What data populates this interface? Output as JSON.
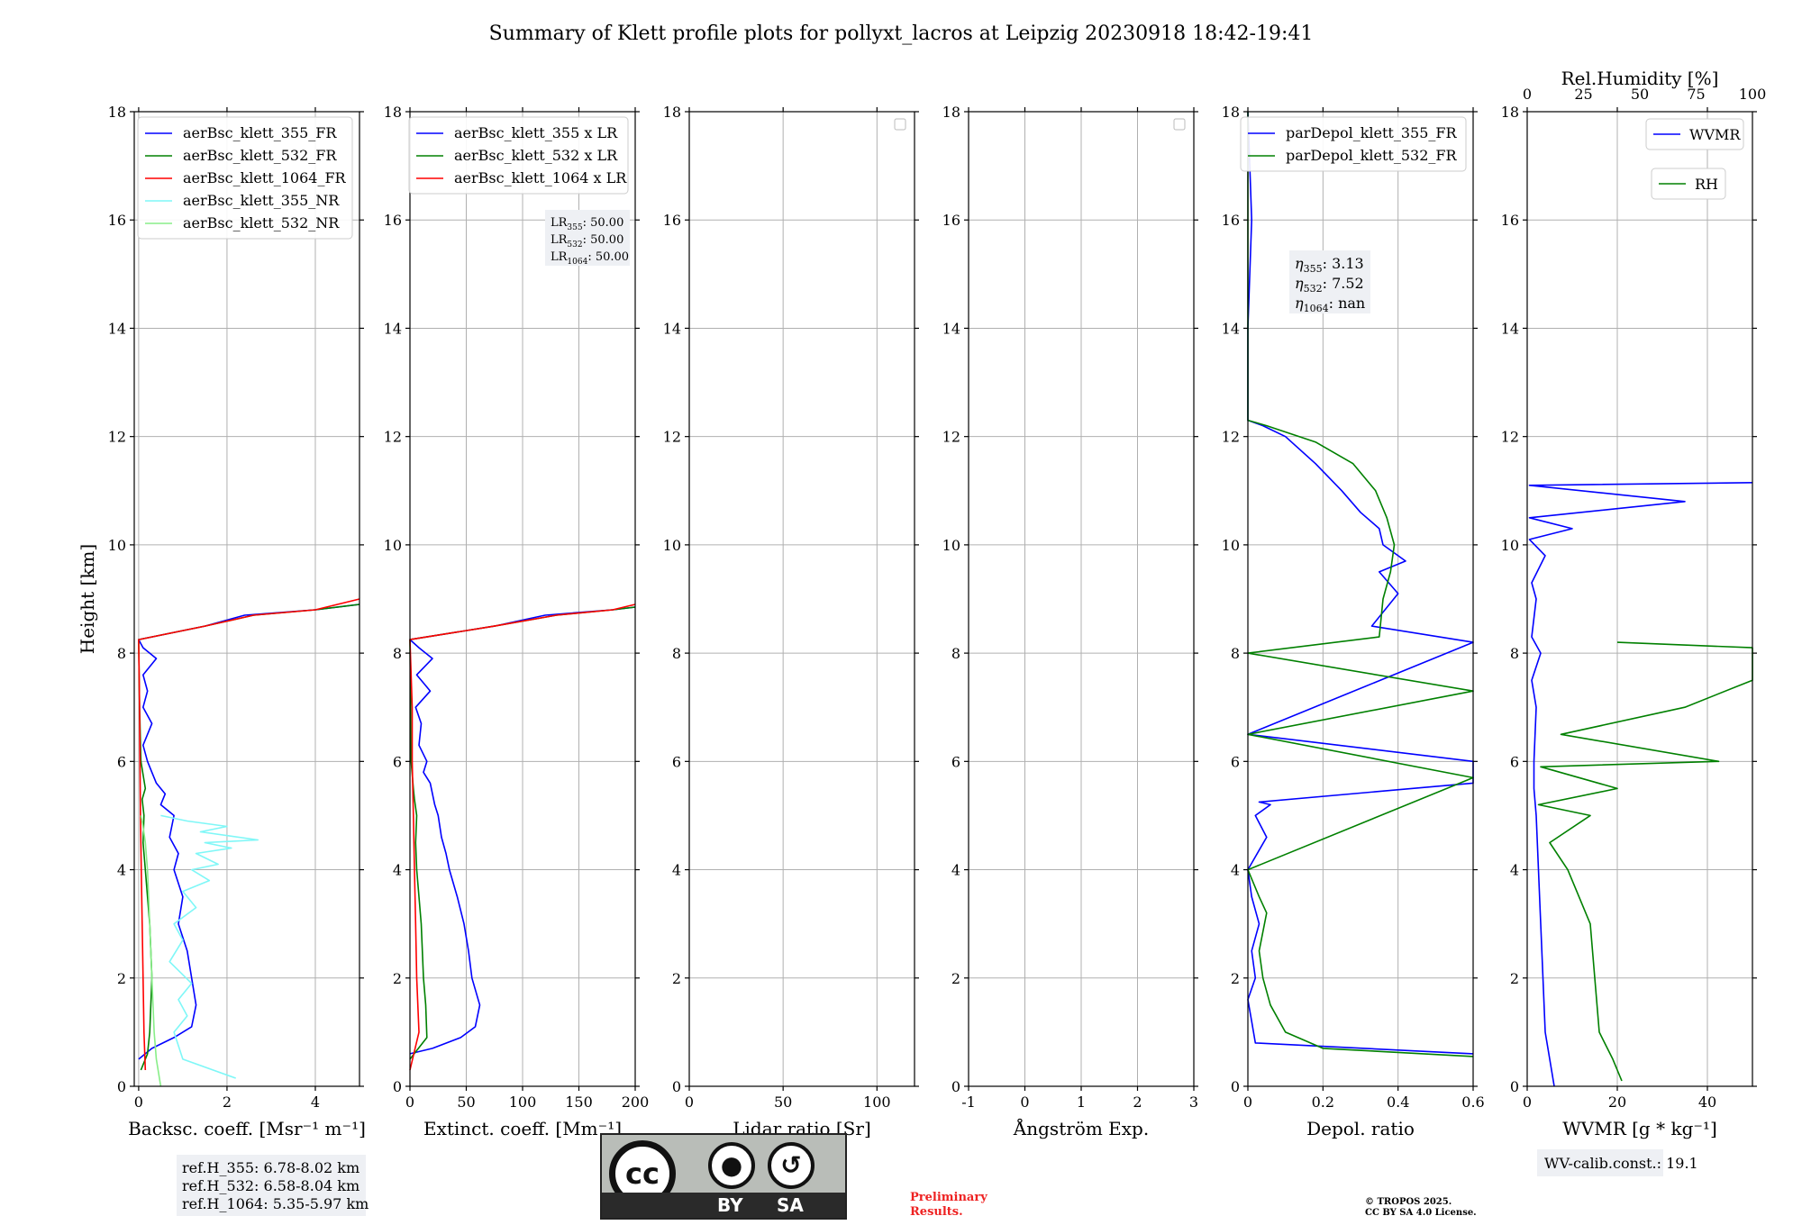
{
  "figure": {
    "title": "Summary of Klett profile plots for pollyxt_lacros at Leipzig 20230918 18:42-19:41",
    "ylabel": "Height [km]",
    "preliminary": [
      "Preliminary",
      "Results."
    ],
    "copyright": [
      "© TROPOS 2025.",
      "CC BY SA 4.0 License."
    ],
    "license": {
      "main": "cc",
      "left": "BY",
      "right": "SA"
    },
    "colors": {
      "b355": "#0000ff",
      "g532": "#008000",
      "r1064": "#ff0000",
      "c355nr": "#7ff7f7",
      "l532nr": "#88ee88"
    }
  },
  "chart_data": [
    {
      "type": "line",
      "xlabel": "Backsc. coeff. [Msr⁻¹ m⁻¹]",
      "xlim": [
        -0.1,
        5
      ],
      "ylim": [
        0,
        18
      ],
      "xticks": [
        0,
        2,
        4
      ],
      "yticks": [
        0,
        2,
        4,
        6,
        8,
        10,
        12,
        14,
        16,
        18
      ],
      "grid": true,
      "legend": "top-right",
      "series": [
        {
          "name": "aerBsc_klett_355_FR",
          "color": "#0000ff",
          "x": [
            0,
            0.3,
            0.8,
            1.2,
            1.3,
            1.2,
            1.1,
            0.9,
            1.0,
            0.8,
            0.9,
            0.7,
            0.8,
            0.5,
            0.6,
            0.4,
            0.3,
            0.2,
            0.1,
            0.3,
            0.1,
            0.2,
            0.1,
            0.4,
            0.1,
            0.0,
            1.5,
            2.4,
            4.0,
            5.0
          ],
          "y": [
            0.5,
            0.7,
            0.9,
            1.1,
            1.5,
            2.0,
            2.5,
            3.0,
            3.5,
            4.0,
            4.3,
            4.6,
            5.0,
            5.2,
            5.4,
            5.6,
            5.8,
            6.0,
            6.3,
            6.7,
            7.0,
            7.3,
            7.6,
            7.9,
            8.1,
            8.25,
            8.5,
            8.7,
            8.8,
            8.9
          ]
        },
        {
          "name": "aerBsc_klett_532_FR",
          "color": "#008000",
          "x": [
            0.05,
            0.2,
            0.25,
            0.3,
            0.25,
            0.2,
            0.15,
            0.1,
            0.12,
            0.08,
            0.15,
            0.05,
            0.02,
            0.0,
            1.5,
            2.6,
            4.0,
            5.0
          ],
          "y": [
            0.3,
            0.6,
            1.0,
            2.0,
            3.0,
            3.5,
            4.0,
            4.5,
            5.0,
            5.3,
            5.5,
            6.0,
            7.0,
            8.25,
            8.5,
            8.7,
            8.8,
            8.9
          ]
        },
        {
          "name": "aerBsc_klett_1064_FR",
          "color": "#ff0000",
          "x": [
            0.15,
            0.12,
            0.1,
            0.08,
            0.06,
            0.04,
            0.03,
            0.02,
            0.0,
            1.5,
            2.6,
            4.0,
            5.0
          ],
          "y": [
            0.3,
            1.0,
            2.0,
            3.0,
            4.0,
            5.0,
            6.0,
            7.0,
            8.25,
            8.5,
            8.7,
            8.8,
            9.0
          ]
        },
        {
          "name": "aerBsc_klett_355_NR",
          "color": "#7ff7f7",
          "x": [
            2.2,
            1.0,
            0.8,
            1.1,
            0.9,
            1.2,
            0.7,
            1.0,
            0.8,
            1.3,
            1.0,
            1.6,
            1.2,
            1.8,
            1.3,
            2.1,
            1.5,
            2.7,
            1.4,
            2.0,
            1.1,
            0.5
          ],
          "y": [
            0.15,
            0.5,
            1.0,
            1.3,
            1.6,
            1.9,
            2.3,
            2.7,
            3.0,
            3.3,
            3.6,
            3.8,
            4.0,
            4.1,
            4.3,
            4.4,
            4.5,
            4.55,
            4.7,
            4.8,
            4.9,
            5.0
          ]
        },
        {
          "name": "aerBsc_klett_532_NR",
          "color": "#88ee88",
          "x": [
            0.5,
            0.4,
            0.35,
            0.3,
            0.25,
            0.2,
            0.15,
            0.1,
            0.05
          ],
          "y": [
            0.0,
            0.5,
            1.0,
            2.0,
            3.0,
            4.0,
            4.5,
            4.8,
            5.0
          ]
        }
      ],
      "note": [
        "ref.H_355: 6.78-8.02 km",
        "ref.H_532: 6.58-8.04 km",
        "ref.H_1064: 5.35-5.97 km"
      ]
    },
    {
      "type": "line",
      "xlabel": "Extinct. coeff. [Mm⁻¹]",
      "xlim": [
        0,
        200
      ],
      "ylim": [
        0,
        18
      ],
      "xticks": [
        0,
        50,
        100,
        150,
        200
      ],
      "yticks": [
        0,
        2,
        4,
        6,
        8,
        10,
        12,
        14,
        16,
        18
      ],
      "grid": true,
      "legend": "top-right",
      "series": [
        {
          "name": "aerBsc_klett_355 x LR",
          "color": "#0000ff",
          "x": [
            0,
            20,
            45,
            58,
            62,
            55,
            52,
            48,
            42,
            35,
            32,
            28,
            25,
            22,
            20,
            18,
            12,
            15,
            8,
            10,
            5,
            18,
            6,
            20,
            8,
            0,
            75,
            120,
            180,
            200
          ],
          "y": [
            0.6,
            0.7,
            0.9,
            1.1,
            1.5,
            2.0,
            2.5,
            3.0,
            3.5,
            4.0,
            4.3,
            4.6,
            5.0,
            5.2,
            5.4,
            5.6,
            5.8,
            6.0,
            6.3,
            6.7,
            7.0,
            7.3,
            7.6,
            7.9,
            8.1,
            8.25,
            8.5,
            8.7,
            8.8,
            8.85
          ]
        },
        {
          "name": "aerBsc_klett_532 x LR",
          "color": "#008000",
          "x": [
            0,
            15,
            14,
            12,
            10,
            8,
            6,
            5,
            6,
            4,
            3,
            1,
            0,
            75,
            130,
            180,
            200
          ],
          "y": [
            0.5,
            0.9,
            1.5,
            2.0,
            3.0,
            3.5,
            4.0,
            4.5,
            5.0,
            5.3,
            5.5,
            6.0,
            8.25,
            8.5,
            8.7,
            8.8,
            8.85
          ]
        },
        {
          "name": "aerBsc_klett_1064 x LR",
          "color": "#ff0000",
          "x": [
            0,
            8,
            6,
            5,
            4,
            3,
            2,
            2,
            0,
            75,
            130,
            180,
            200
          ],
          "y": [
            0.3,
            1.0,
            2.0,
            3.0,
            4.0,
            5.0,
            6.0,
            7.0,
            8.25,
            8.5,
            8.7,
            8.8,
            8.9
          ]
        }
      ],
      "lr_box": [
        {
          "sub": "355",
          "value": ": 50.00"
        },
        {
          "sub": "532",
          "value": ": 50.00"
        },
        {
          "sub": "1064",
          "value": ": 50.00"
        }
      ]
    },
    {
      "type": "line",
      "xlabel": "Lidar ratio [Sr]",
      "xlim": [
        0,
        120
      ],
      "ylim": [
        0,
        18
      ],
      "xticks": [
        0,
        50,
        100
      ],
      "yticks": [
        0,
        2,
        4,
        6,
        8,
        10,
        12,
        14,
        16,
        18
      ],
      "grid": true,
      "legend": "top-right",
      "series": []
    },
    {
      "type": "line",
      "xlabel": "Ångström Exp.",
      "xlim": [
        -1,
        3
      ],
      "ylim": [
        0,
        18
      ],
      "xticks": [
        -1,
        0,
        1,
        2,
        3
      ],
      "yticks": [
        0,
        2,
        4,
        6,
        8,
        10,
        12,
        14,
        16,
        18
      ],
      "grid": true,
      "legend": "top-right",
      "series": []
    },
    {
      "type": "line",
      "xlabel": "Depol. ratio",
      "xlim": [
        0,
        0.6
      ],
      "ylim": [
        0,
        18
      ],
      "xticks": [
        0.0,
        0.2,
        0.4,
        0.6
      ],
      "yticks": [
        0,
        2,
        4,
        6,
        8,
        10,
        12,
        14,
        16,
        18
      ],
      "grid": true,
      "legend": "top-right",
      "series": [
        {
          "name": "parDepol_klett_355_FR",
          "color": "#0000ff",
          "x": [
            0.6,
            0.02,
            0.01,
            0.0,
            0.02,
            0.01,
            0.03,
            0.01,
            0.0,
            0.05,
            0.02,
            0.06,
            0.03,
            0.6,
            0.6,
            0.0,
            0.6,
            0.33,
            0.4,
            0.35,
            0.42,
            0.36,
            0.35,
            0.3,
            0.25,
            0.18,
            0.1,
            0.04,
            0.0,
            0.0,
            0.01,
            0.0
          ],
          "y": [
            0.6,
            0.8,
            1.2,
            1.6,
            2.0,
            2.5,
            3.0,
            3.5,
            4.0,
            4.6,
            5.0,
            5.2,
            5.25,
            5.6,
            6.0,
            6.5,
            8.2,
            8.5,
            9.1,
            9.5,
            9.7,
            10.0,
            10.3,
            10.6,
            11.0,
            11.5,
            12.0,
            12.2,
            12.3,
            14.0,
            16.0,
            18.0
          ]
        },
        {
          "name": "parDepol_klett_532_FR",
          "color": "#008000",
          "x": [
            0.6,
            0.2,
            0.1,
            0.06,
            0.04,
            0.03,
            0.05,
            0.03,
            0.0,
            0.6,
            0.0,
            0.6,
            0.0,
            0.35,
            0.36,
            0.38,
            0.39,
            0.37,
            0.34,
            0.28,
            0.18,
            0.05,
            0.0,
            0.0
          ],
          "y": [
            0.55,
            0.7,
            1.0,
            1.5,
            2.0,
            2.5,
            3.2,
            3.5,
            4.0,
            5.7,
            6.5,
            7.3,
            8.0,
            8.3,
            9.0,
            9.5,
            10.0,
            10.5,
            11.0,
            11.5,
            11.9,
            12.2,
            12.3,
            18.0
          ]
        }
      ],
      "eta_box": [
        {
          "sub": "355",
          "value": ": 3.13"
        },
        {
          "sub": "532",
          "value": ": 7.52"
        },
        {
          "sub": "1064",
          "value": ": nan"
        }
      ]
    },
    {
      "type": "line",
      "xlabel": "WVMR [g * kg⁻¹]",
      "xlim": [
        0,
        50
      ],
      "ylim": [
        0,
        18
      ],
      "xticks": [
        0,
        20,
        40
      ],
      "yticks": [
        0,
        2,
        4,
        6,
        8,
        10,
        12,
        14,
        16,
        18
      ],
      "grid": true,
      "legend": "top-right",
      "top_axis": {
        "label": "Rel.Humidity [%]",
        "lim": [
          0,
          100
        ],
        "ticks": [
          0,
          25,
          50,
          75,
          100
        ]
      },
      "series": [
        {
          "name": "WVMR",
          "color": "#0000ff",
          "x": [
            6,
            5,
            4,
            3.5,
            3,
            2.5,
            2,
            1.5,
            1.5,
            2,
            1,
            3,
            1,
            2,
            1,
            4,
            0.5,
            10,
            0.5,
            35,
            0.5,
            50
          ],
          "y": [
            0.0,
            0.5,
            1.0,
            2.0,
            3.0,
            4.0,
            5.0,
            5.5,
            6.0,
            7.0,
            7.5,
            8.0,
            8.3,
            9.0,
            9.3,
            9.8,
            10.1,
            10.3,
            10.5,
            10.8,
            11.1,
            11.15
          ]
        },
        {
          "name": "RH",
          "color": "#008000",
          "x": [
            42,
            38,
            32,
            30,
            28,
            22,
            18,
            10,
            28,
            5,
            40,
            6,
            85,
            15,
            70,
            100,
            100,
            40
          ],
          "y": [
            0.1,
            0.5,
            1.0,
            2.0,
            3.0,
            3.6,
            4.0,
            4.5,
            5.0,
            5.2,
            5.5,
            5.9,
            6.0,
            6.5,
            7.0,
            7.5,
            8.1,
            8.2
          ]
        }
      ],
      "calib_box": "WV-calib.const.: 19.1"
    }
  ]
}
